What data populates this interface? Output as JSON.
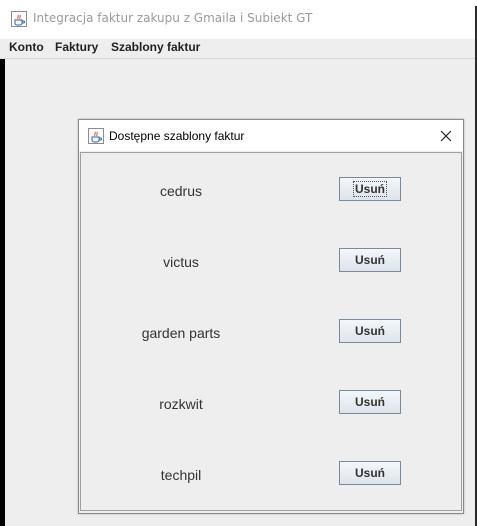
{
  "window": {
    "title": "Integracja faktur zakupu z Gmaila i Subiekt GT",
    "icon": "java-cup-icon"
  },
  "menu": {
    "items": [
      "Konto",
      "Faktury",
      "Szablony faktur"
    ]
  },
  "dialog": {
    "title": "Dostępne szablony faktur",
    "icon": "java-cup-icon",
    "close_icon": "close-icon",
    "templates": [
      {
        "name": "cedrus",
        "button_label": "Usuń",
        "focused": true
      },
      {
        "name": "victus",
        "button_label": "Usuń",
        "focused": false
      },
      {
        "name": "garden parts",
        "button_label": "Usuń",
        "focused": false
      },
      {
        "name": "rozkwit",
        "button_label": "Usuń",
        "focused": false
      },
      {
        "name": "techpil",
        "button_label": "Usuń",
        "focused": false
      }
    ]
  },
  "colors": {
    "title_text_inactive": "#9a9a9a",
    "window_background": "#eeeeee",
    "button_border": "#7a8a99"
  }
}
